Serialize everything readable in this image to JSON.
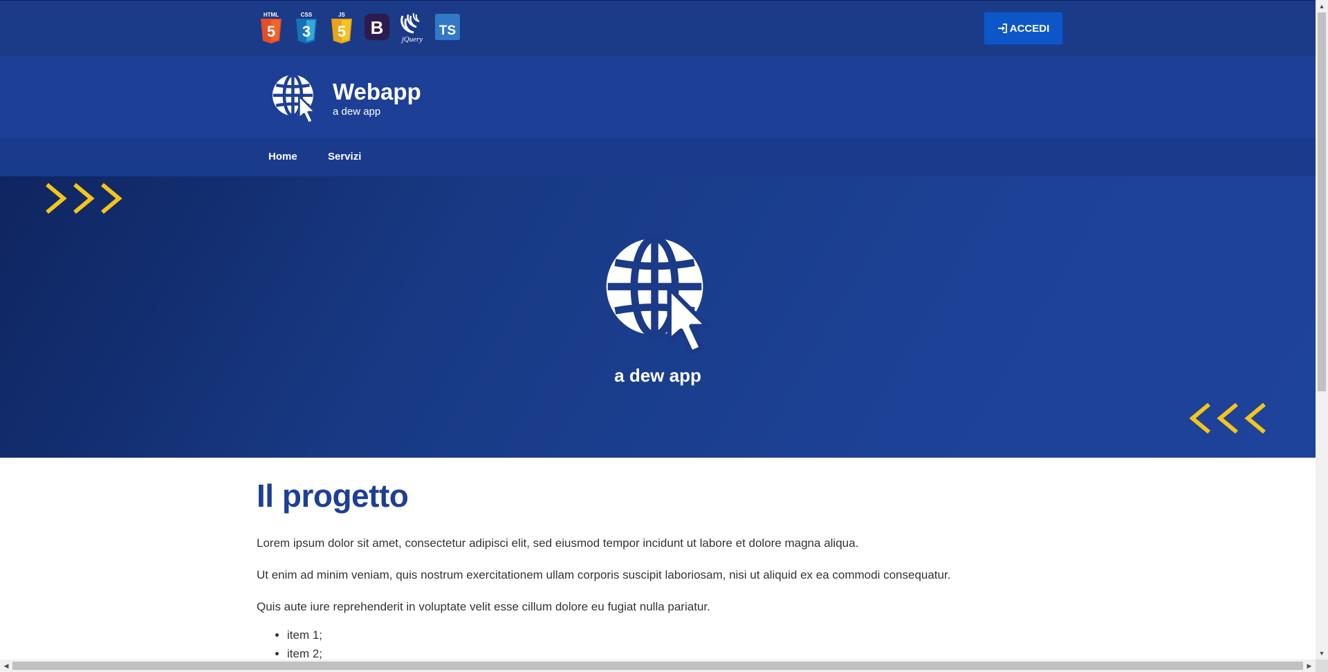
{
  "topbar": {
    "tech_icons": [
      {
        "name": "html5-icon",
        "label": "HTML",
        "glyph": "5",
        "color": "#e44d26"
      },
      {
        "name": "css3-icon",
        "label": "CSS",
        "glyph": "3",
        "color": "#1572b6"
      },
      {
        "name": "javascript-icon",
        "label": "JS",
        "glyph": "5",
        "color": "#f0a30a"
      },
      {
        "name": "bootstrap-icon",
        "label": "",
        "glyph": "B",
        "color": "#2d1a4e"
      },
      {
        "name": "jquery-icon",
        "label": "jQuery",
        "glyph": "",
        "color": "#ffffff"
      },
      {
        "name": "typescript-icon",
        "label": "",
        "glyph": "TS",
        "color": "#3178c6"
      }
    ],
    "login_label": "ACCEDI"
  },
  "header": {
    "title": "Webapp",
    "subtitle": "a dew app"
  },
  "nav": {
    "items": [
      {
        "label": "Home"
      },
      {
        "label": "Servizi"
      }
    ]
  },
  "hero": {
    "subtitle": "a dew app",
    "chevron_color": "#f5c518"
  },
  "content": {
    "heading": "Il progetto",
    "paragraphs": [
      "Lorem ipsum dolor sit amet, consectetur adipisci elit, sed eiusmod tempor incidunt ut labore et dolore magna aliqua.",
      "Ut enim ad minim veniam, quis nostrum exercitationem ullam corporis suscipit laboriosam, nisi ut aliquid ex ea commodi consequatur.",
      "Quis aute iure reprehenderit in voluptate velit esse cillum dolore eu fugiat nulla pariatur."
    ],
    "list_items": [
      "item 1;",
      "item 2;"
    ]
  },
  "colors": {
    "topbar": "#1b3a87",
    "header": "#1d3f95",
    "nav": "#1a3b8c",
    "accent": "#0d56c8",
    "heading": "#1d3f95"
  }
}
